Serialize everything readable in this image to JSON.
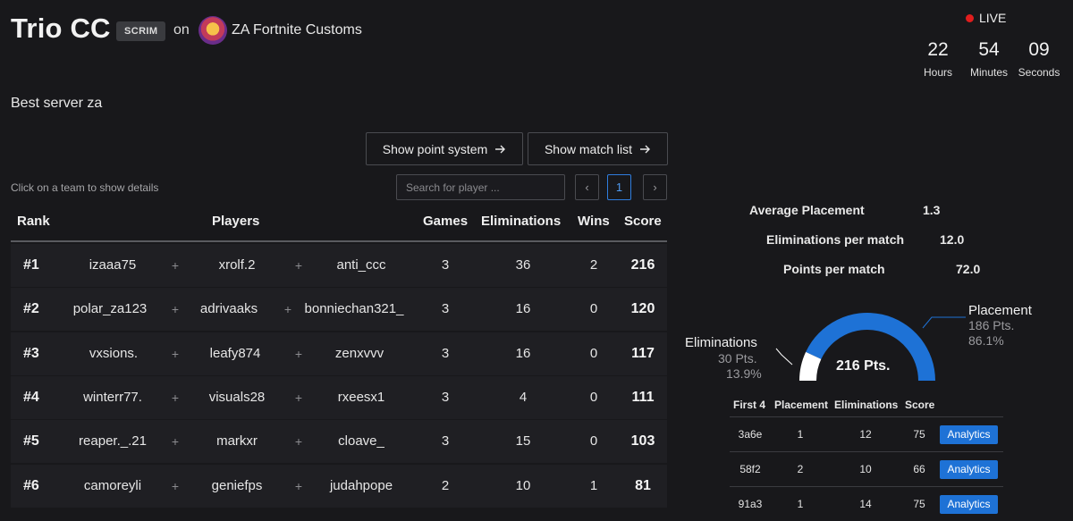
{
  "header": {
    "title": "Trio CC",
    "badge": "SCRIM",
    "on": "on",
    "org_name": "ZA Fortnite Customs",
    "description": "Best server za",
    "live_label": "LIVE",
    "countdown": [
      {
        "value": "22",
        "unit": "Hours"
      },
      {
        "value": "54",
        "unit": "Minutes"
      },
      {
        "value": "09",
        "unit": "Seconds"
      }
    ]
  },
  "buttons": {
    "point_system": "Show point system",
    "match_list": "Show match list"
  },
  "toolbar": {
    "hint": "Click on a team to show details",
    "search_placeholder": "Search for player ...",
    "page_prev": "‹",
    "page_current": "1",
    "page_next": "›"
  },
  "table": {
    "headers": {
      "rank": "Rank",
      "players": "Players",
      "games": "Games",
      "eliminations": "Eliminations",
      "wins": "Wins",
      "score": "Score"
    },
    "rows": [
      {
        "rank": "#1",
        "p1": "izaaa75",
        "p2": "xrolf.2",
        "p3": "anti_ccc",
        "games": "3",
        "elims": "36",
        "wins": "2",
        "score": "216"
      },
      {
        "rank": "#2",
        "p1": "polar_za123",
        "p2": "adrivaaks",
        "p3": "bonniechan321_",
        "games": "3",
        "elims": "16",
        "wins": "0",
        "score": "120"
      },
      {
        "rank": "#3",
        "p1": "vxsions.",
        "p2": "leafy874",
        "p3": "zenxvvv",
        "games": "3",
        "elims": "16",
        "wins": "0",
        "score": "117"
      },
      {
        "rank": "#4",
        "p1": "winterr77.",
        "p2": "visuals28",
        "p3": "rxeesx1",
        "games": "3",
        "elims": "4",
        "wins": "0",
        "score": "111"
      },
      {
        "rank": "#5",
        "p1": "reaper._.21",
        "p2": "markxr",
        "p3": "cloave_",
        "games": "3",
        "elims": "15",
        "wins": "0",
        "score": "103"
      },
      {
        "rank": "#6",
        "p1": "camoreyli",
        "p2": "geniefps",
        "p3": "judahpope",
        "games": "2",
        "elims": "10",
        "wins": "1",
        "score": "81"
      }
    ]
  },
  "detail": {
    "stats": [
      {
        "label": "Average Placement",
        "value": "1.3"
      },
      {
        "label": "Eliminations per match",
        "value": "12.0"
      },
      {
        "label": "Points per match",
        "value": "72.0"
      }
    ],
    "donut": {
      "total": "216 Pts.",
      "eliminations": {
        "label": "Eliminations",
        "points": "30 Pts.",
        "percent": "13.9%",
        "fraction": 0.139,
        "color": "#ffffff"
      },
      "placement": {
        "label": "Placement",
        "points": "186 Pts.",
        "percent": "86.1%",
        "fraction": 0.861,
        "color": "#1e72d6"
      }
    },
    "matches": {
      "headers": {
        "id": "First 4",
        "placement": "Placement",
        "eliminations": "Eliminations",
        "score": "Score"
      },
      "rows": [
        {
          "id": "3a6e",
          "placement": "1",
          "eliminations": "12",
          "score": "75",
          "action": "Analytics"
        },
        {
          "id": "58f2",
          "placement": "2",
          "eliminations": "10",
          "score": "66",
          "action": "Analytics"
        },
        {
          "id": "91a3",
          "placement": "1",
          "eliminations": "14",
          "score": "75",
          "action": "Analytics"
        }
      ]
    }
  }
}
